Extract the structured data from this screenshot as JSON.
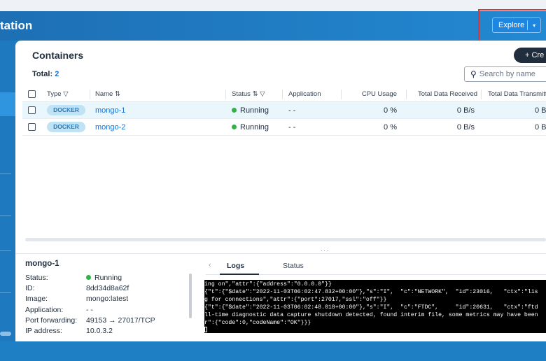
{
  "app": {
    "title": "tation"
  },
  "header": {
    "explore_label": "Explore",
    "explore_caret": "▾"
  },
  "containers": {
    "title": "Containers",
    "total_label": "Total:",
    "total_count": "2",
    "create_label": "+ Cre",
    "search_placeholder": "Search by name",
    "columns": {
      "type": "Type",
      "name": "Name",
      "status": "Status",
      "application": "Application",
      "cpu": "CPU Usage",
      "received": "Total Data Received",
      "transmitted": "Total Data Transmitt"
    },
    "rows": [
      {
        "type": "DOCKER",
        "name": "mongo-1",
        "status": "Running",
        "application": "- -",
        "cpu": "0 %",
        "received": "0 B/s",
        "transmitted": "0 B"
      },
      {
        "type": "DOCKER",
        "name": "mongo-2",
        "status": "Running",
        "application": "- -",
        "cpu": "0 %",
        "received": "0 B/s",
        "transmitted": "0 B"
      }
    ]
  },
  "splitter": {
    "grip": "···"
  },
  "details": {
    "title": "mongo-1",
    "fields": [
      {
        "key": "Status:",
        "value": "Running"
      },
      {
        "key": "ID:",
        "value": "8dd34d8a62f"
      },
      {
        "key": "Image:",
        "value": "mongo:latest"
      },
      {
        "key": "Application:",
        "value": "- -"
      },
      {
        "key": "Port forwarding:",
        "value": "49153 → 27017/TCP"
      },
      {
        "key": "IP address:",
        "value": "10.0.3.2"
      }
    ],
    "tabs": {
      "logs": "Logs",
      "status": "Status"
    },
    "log_lines": [
      "ing on\",\"attr\":{\"address\":\"0.0.0.0\"}}",
      "{\"t\":{\"$date\":\"2022-11-03T06:02:47.832+00:00\"},\"s\":\"I\",  \"c\":\"NETWORK\",  \"id\":23016,   \"ctx\":\"lis",
      "g for connections\",\"attr\":{\"port\":27017,\"ssl\":\"off\"}}",
      "{\"t\":{\"$date\":\"2022-11-03T06:02:48.018+00:00\"},\"s\":\"I\",  \"c\":\"FTDC\",     \"id\":20631,   \"ctx\":\"ftd",
      "ll-time diagnostic data capture shutdown detected, found interim file, some metrics may have been",
      "r\":{\"code\":0,\"codeName\":\"OK\"}}}"
    ]
  },
  "colors": {
    "accent": "#1f86e0",
    "running": "#2fb344",
    "header": "#1e6fb4"
  }
}
